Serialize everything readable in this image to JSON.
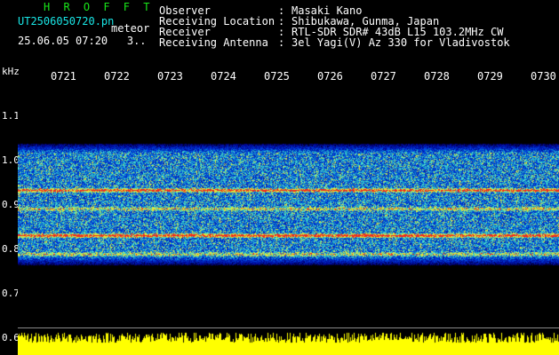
{
  "header": {
    "brand": "H R O F F T",
    "filename": "UT2506050720.pn",
    "event_type": "meteor",
    "datetime": "25.06.05 07:20",
    "count": "3.."
  },
  "meta": [
    {
      "label": "Observer",
      "value": "Masaki Kano"
    },
    {
      "label": "Receiving Location",
      "value": "Shibukawa, Gunma, Japan"
    },
    {
      "label": "Receiver",
      "value": "RTL-SDR SDR# 43dB L15 103.2MHz CW"
    },
    {
      "label": "Receiving Antenna",
      "value": "3el Yagi(V) Az 330 for Vladivostok"
    }
  ],
  "axis": {
    "unit": "kHz",
    "y_ticks": [
      "1.1",
      "1.0",
      "0.9",
      "0.8",
      "0.7",
      "0.6"
    ],
    "x_ticks": [
      "0721",
      "0722",
      "0723",
      "0724",
      "0725",
      "0726",
      "0727",
      "0728",
      "0729",
      "0730"
    ]
  },
  "colors": {
    "background": "#000000",
    "brand": "#19e619",
    "filename": "#19e6e6",
    "signal": "#ffff00"
  }
}
